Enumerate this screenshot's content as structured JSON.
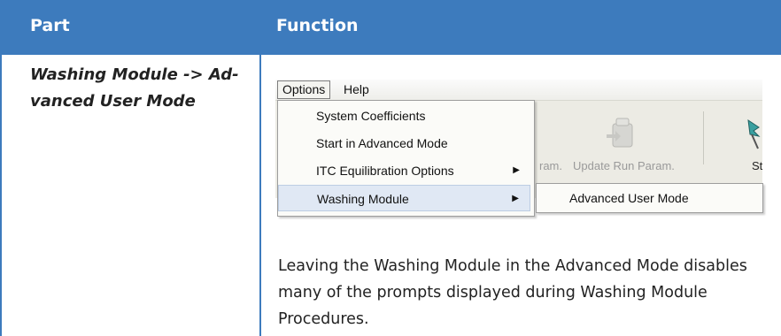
{
  "table": {
    "header": {
      "part": "Part",
      "function": "Function"
    },
    "row": {
      "part": "Washing Module -> Ad-vanced User Mode",
      "description": "Leaving the Washing Module in the Advanced Mode disables many of the prompts displayed during Washing Module Procedures."
    }
  },
  "screenshot": {
    "menubar": {
      "options": "Options",
      "help": "Help"
    },
    "options_menu": [
      {
        "label": "System Coefficients",
        "has_submenu": false
      },
      {
        "label": "Start in Advanced Mode",
        "has_submenu": false
      },
      {
        "label": "ITC Equilibration Options",
        "has_submenu": true
      },
      {
        "label": "Washing Module",
        "has_submenu": true,
        "highlighted": true
      }
    ],
    "submenu": {
      "item": "Advanced User Mode"
    },
    "toolbar": {
      "label_partial": "ram.",
      "update_label": "Update Run Param.",
      "label_cut": "St"
    }
  },
  "colors": {
    "header_bg": "#3d7bbd",
    "header_text": "#ffffff"
  }
}
